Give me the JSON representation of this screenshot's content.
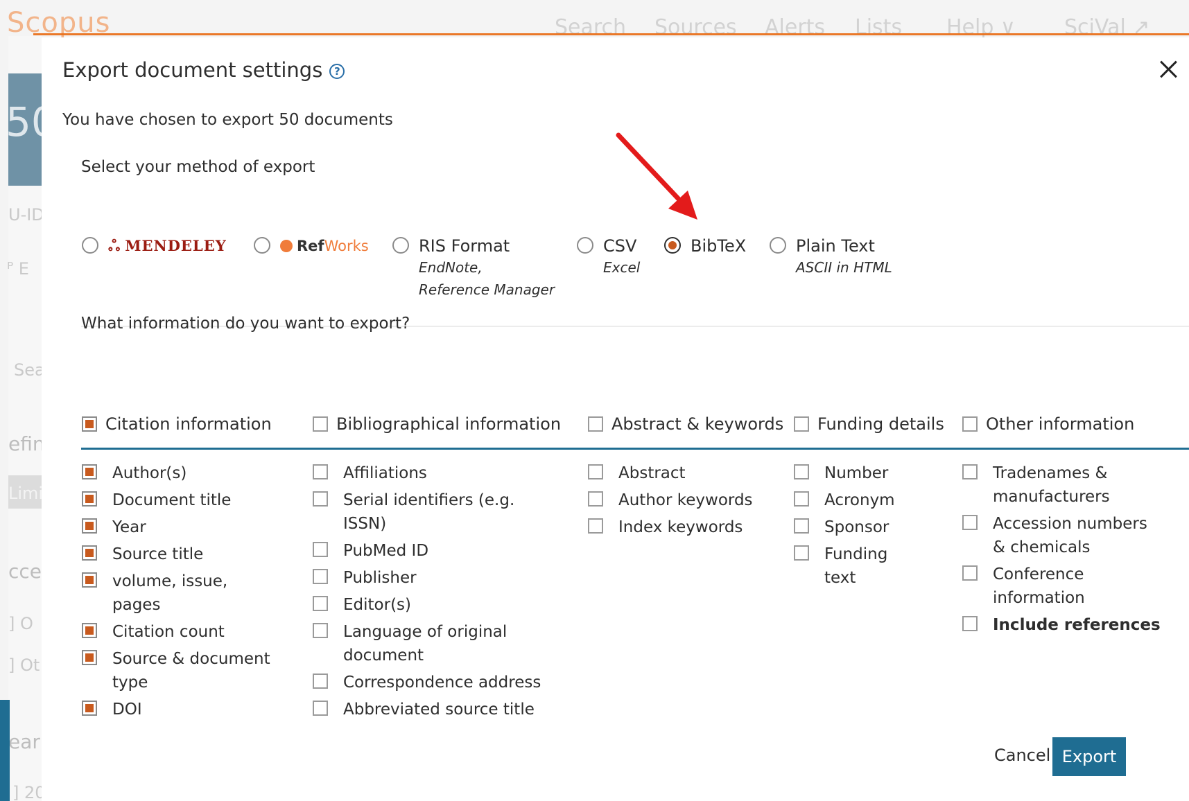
{
  "background": {
    "logo": "Scopus",
    "nav": [
      "Search",
      "Sources",
      "Alerts",
      "Lists",
      "Help ∨",
      "SciVal ↗"
    ],
    "count_fragment": "50",
    "fragments": [
      "U-ID",
      "ᴾ E",
      "Sea",
      "efin",
      "Limi",
      "cce",
      "] O",
      "] Ot",
      "ear",
      "] 20"
    ]
  },
  "modal": {
    "title": "Export document settings",
    "help_glyph": "?",
    "subtitle": "You have chosen to export 50 documents",
    "method_label": "Select your method of export",
    "methods": [
      {
        "logo": "MENDELEY",
        "logo_glyph": "ஃ",
        "checked": false
      },
      {
        "logo_ref": "Ref",
        "logo_works": "Works",
        "checked": false
      },
      {
        "label": "RIS Format",
        "sub1": "EndNote,",
        "sub2": "Reference Manager",
        "checked": false
      },
      {
        "label": "CSV",
        "sub1": "Excel",
        "checked": false
      },
      {
        "label": "BibTeX",
        "checked": true
      },
      {
        "label": "Plain Text",
        "sub1": "ASCII in HTML",
        "checked": false
      }
    ],
    "info_label": "What information do you want to export?",
    "categories": [
      {
        "label": "Citation information",
        "checked": true
      },
      {
        "label": "Bibliographical information",
        "checked": false
      },
      {
        "label": "Abstract & keywords",
        "checked": false
      },
      {
        "label": "Funding details",
        "checked": false
      },
      {
        "label": "Other information",
        "checked": false
      }
    ],
    "columns": {
      "citation": [
        {
          "l1": "Author(s)",
          "checked": true
        },
        {
          "l1": "Document title",
          "checked": true
        },
        {
          "l1": "Year",
          "checked": true
        },
        {
          "l1": "Source title",
          "checked": true
        },
        {
          "l1": "volume, issue,",
          "l2": "pages",
          "checked": true
        },
        {
          "l1": "Citation count",
          "checked": true
        },
        {
          "l1": "Source & document",
          "l2": "type",
          "checked": true
        },
        {
          "l1": "DOI",
          "checked": true
        }
      ],
      "bibliographical": [
        {
          "l1": "Affiliations",
          "checked": false
        },
        {
          "l1": "Serial identifiers (e.g.",
          "l2": "ISSN)",
          "checked": false
        },
        {
          "l1": "PubMed ID",
          "checked": false
        },
        {
          "l1": "Publisher",
          "checked": false
        },
        {
          "l1": "Editor(s)",
          "checked": false
        },
        {
          "l1": "Language of original",
          "l2": "document",
          "checked": false
        },
        {
          "l1": "Correspondence address",
          "checked": false
        },
        {
          "l1": "Abbreviated source title",
          "checked": false
        }
      ],
      "abstract": [
        {
          "l1": "Abstract",
          "checked": false
        },
        {
          "l1": "Author keywords",
          "checked": false
        },
        {
          "l1": "Index keywords",
          "checked": false
        }
      ],
      "funding": [
        {
          "l1": "Number",
          "checked": false
        },
        {
          "l1": "Acronym",
          "checked": false
        },
        {
          "l1": "Sponsor",
          "checked": false
        },
        {
          "l1": "Funding",
          "l2": "text",
          "checked": false
        }
      ],
      "other": [
        {
          "l1": "Tradenames &",
          "l2": "manufacturers",
          "checked": false
        },
        {
          "l1": "Accession numbers",
          "l2": "& chemicals",
          "checked": false
        },
        {
          "l1": "Conference",
          "l2": "information",
          "checked": false
        },
        {
          "l1": "Include references",
          "checked": false,
          "bold": true
        }
      ]
    },
    "cancel_label": "Cancel",
    "export_label": "Export"
  },
  "colors": {
    "accent_orange": "#c85a1e",
    "primary_blue": "#1f6d92",
    "annotation_red": "#e31b1b"
  }
}
